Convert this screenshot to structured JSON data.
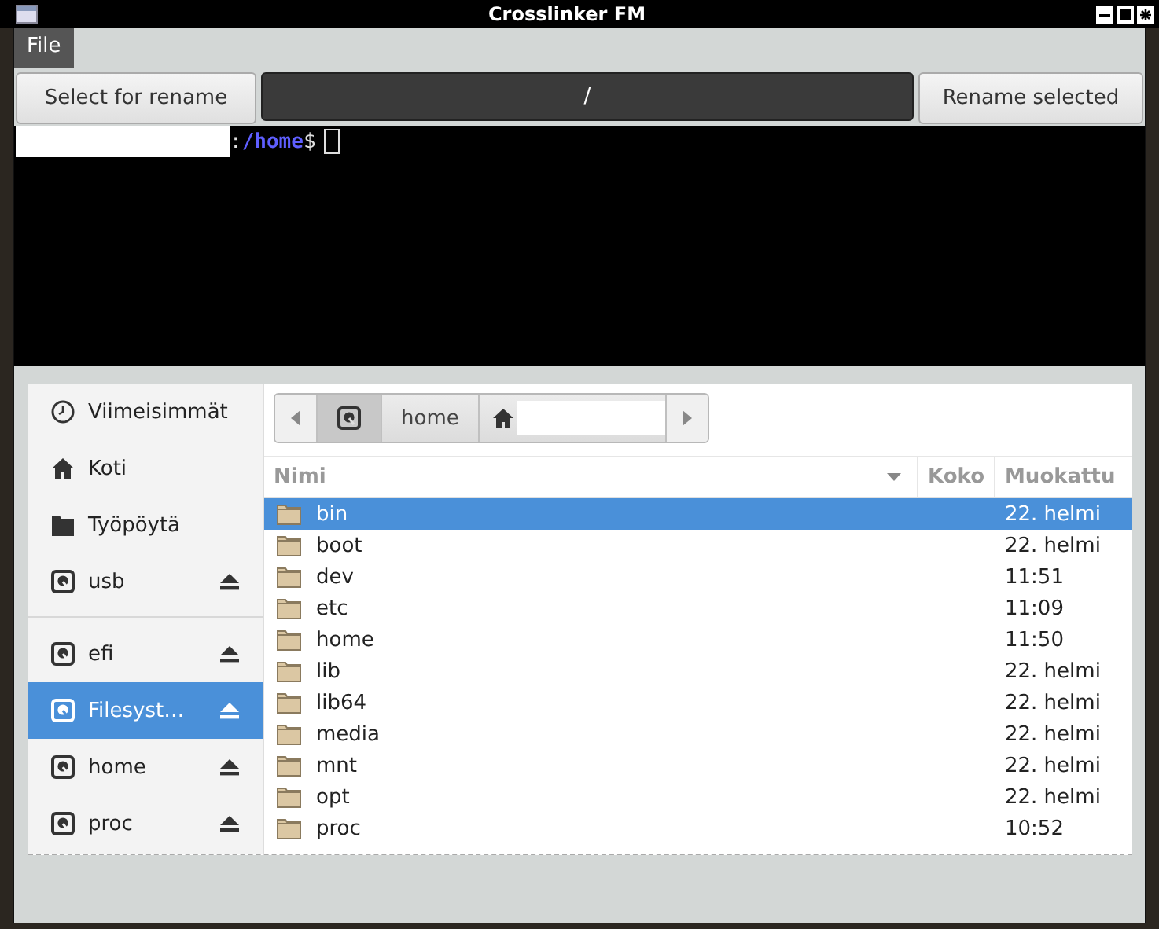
{
  "window": {
    "title": "Crosslinker FM"
  },
  "menu": [
    {
      "label": "File",
      "selected": true
    }
  ],
  "toolbar": {
    "left_button": "Select for rename",
    "path": "/",
    "right_button": "Rename selected"
  },
  "terminal": {
    "separator": ":",
    "directory": "/home",
    "symbol": "$"
  },
  "pathbar": [
    {
      "kind": "drive",
      "selected": true
    },
    {
      "kind": "text",
      "label": "home",
      "selected": false
    },
    {
      "kind": "home",
      "selected": false
    }
  ],
  "sidebar": {
    "sections": [
      [
        {
          "label": "Viimeisimmät",
          "kind": "recent",
          "eject": false,
          "selected": false
        },
        {
          "label": "Koti",
          "kind": "home",
          "eject": false,
          "selected": false
        },
        {
          "label": "Työpöytä",
          "kind": "folder",
          "eject": false,
          "selected": false
        },
        {
          "label": "usb",
          "kind": "drive",
          "eject": true,
          "selected": false
        }
      ],
      [
        {
          "label": "efi",
          "kind": "drive",
          "eject": true,
          "selected": false
        },
        {
          "label": "Filesyst…",
          "kind": "drive",
          "eject": true,
          "selected": true
        },
        {
          "label": "home",
          "kind": "drive",
          "eject": true,
          "selected": false
        },
        {
          "label": "proc",
          "kind": "drive",
          "eject": true,
          "selected": false
        }
      ]
    ]
  },
  "table": {
    "columns": [
      {
        "label": "Nimi",
        "sorted": true
      },
      {
        "label": "Koko",
        "sorted": false
      },
      {
        "label": "Muokattu",
        "sorted": false
      }
    ],
    "rows": [
      {
        "name": "bin",
        "modified": "22. helmi",
        "selected": true
      },
      {
        "name": "boot",
        "modified": "22. helmi",
        "selected": false
      },
      {
        "name": "dev",
        "modified": "11:51",
        "selected": false
      },
      {
        "name": "etc",
        "modified": "11:09",
        "selected": false
      },
      {
        "name": "home",
        "modified": "11:50",
        "selected": false
      },
      {
        "name": "lib",
        "modified": "22. helmi",
        "selected": false
      },
      {
        "name": "lib64",
        "modified": "22. helmi",
        "selected": false
      },
      {
        "name": "media",
        "modified": "22. helmi",
        "selected": false
      },
      {
        "name": "mnt",
        "modified": "22. helmi",
        "selected": false
      },
      {
        "name": "opt",
        "modified": "22. helmi",
        "selected": false
      },
      {
        "name": "proc",
        "modified": "10:52",
        "selected": false
      }
    ]
  }
}
